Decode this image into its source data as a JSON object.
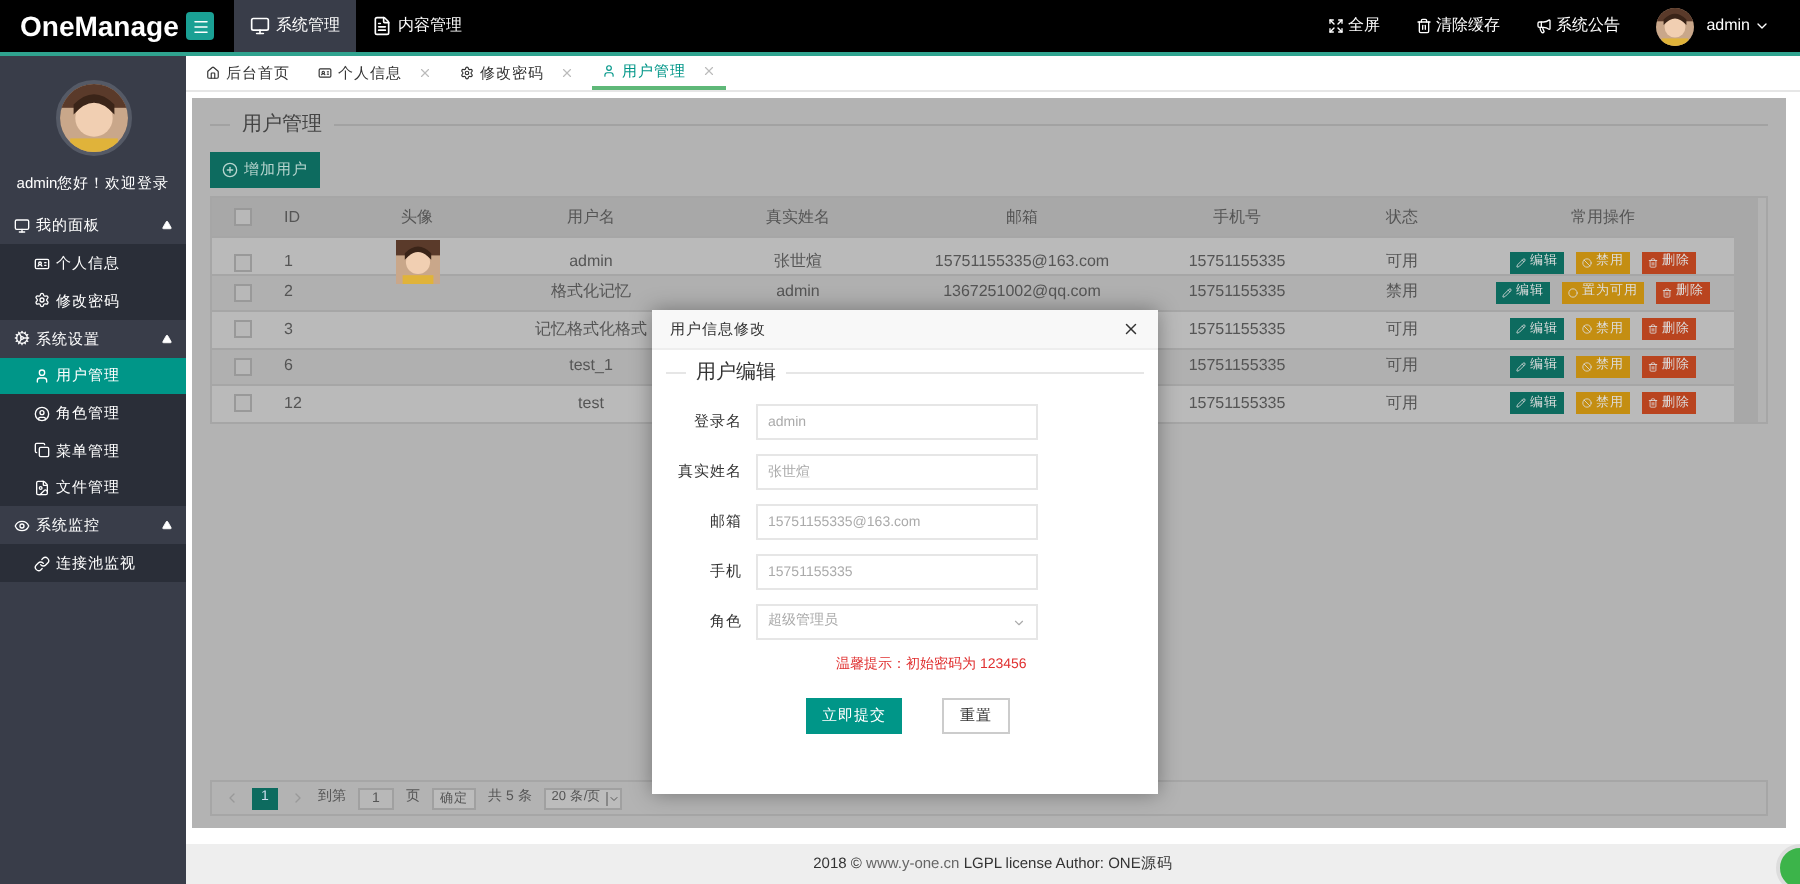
{
  "topbar": {
    "logo": "OneManage",
    "nav": [
      {
        "label": "系统管理",
        "selected": true
      },
      {
        "label": "内容管理",
        "selected": false
      }
    ],
    "actions": [
      "全屏",
      "清除缓存",
      "系统公告"
    ],
    "user": "admin"
  },
  "sidebar": {
    "greeting": "admin您好！欢迎登录",
    "groups": [
      {
        "label": "我的面板",
        "expanded": true,
        "children": [
          {
            "label": "个人信息",
            "selected": false
          },
          {
            "label": "修改密码",
            "selected": false
          }
        ]
      },
      {
        "label": "系统设置",
        "expanded": true,
        "children": [
          {
            "label": "用户管理",
            "selected": true
          },
          {
            "label": "角色管理",
            "selected": false
          },
          {
            "label": "菜单管理",
            "selected": false
          },
          {
            "label": "文件管理",
            "selected": false
          }
        ]
      },
      {
        "label": "系统监控",
        "expanded": true,
        "children": [
          {
            "label": "连接池监视",
            "selected": false
          }
        ]
      }
    ]
  },
  "tabs": [
    {
      "label": "后台首页",
      "closable": false,
      "selected": false
    },
    {
      "label": "个人信息",
      "closable": true,
      "selected": false
    },
    {
      "label": "修改密码",
      "closable": true,
      "selected": false
    },
    {
      "label": "用户管理",
      "closable": true,
      "selected": true
    }
  ],
  "panel": {
    "title": "用户管理",
    "add_button": "增加用户",
    "table": {
      "all_checked": false,
      "columns": [
        "ID",
        "头像",
        "用户名",
        "真实姓名",
        "邮箱",
        "手机号",
        "状态",
        "常用操作"
      ],
      "rows": [
        {
          "checked": false,
          "id": "1",
          "avatar": {
            "kind": "picture"
          },
          "username": "admin",
          "real_name": "张世煊",
          "email": "15751155335@163.com",
          "phone": "15751155335",
          "status": "可用",
          "actions": [
            {
              "kind": "edit",
              "label": "编辑"
            },
            {
              "kind": "disable",
              "label": "禁用"
            },
            {
              "kind": "delete",
              "label": "删除"
            }
          ]
        },
        {
          "checked": false,
          "id": "2",
          "username": "格式化记忆",
          "real_name": "admin",
          "email": "1367251002@qq.com",
          "phone": "15751155335",
          "status": "禁用",
          "actions": [
            {
              "kind": "edit",
              "label": "编辑"
            },
            {
              "kind": "enable",
              "label": "置为可用"
            },
            {
              "kind": "delete",
              "label": "删除"
            }
          ]
        },
        {
          "checked": false,
          "id": "3",
          "username": "记忆格式化格式",
          "phone": "15751155335",
          "status": "可用",
          "actions": [
            {
              "kind": "edit",
              "label": "编辑"
            },
            {
              "kind": "disable",
              "label": "禁用"
            },
            {
              "kind": "delete",
              "label": "删除"
            }
          ]
        },
        {
          "checked": false,
          "id": "6",
          "username": "test_1",
          "phone": "15751155335",
          "status": "可用",
          "actions": [
            {
              "kind": "edit",
              "label": "编辑"
            },
            {
              "kind": "disable",
              "label": "禁用"
            },
            {
              "kind": "delete",
              "label": "删除"
            }
          ]
        },
        {
          "checked": false,
          "id": "12",
          "username": "test",
          "phone": "15751155335",
          "status": "可用",
          "actions": [
            {
              "kind": "edit",
              "label": "编辑"
            },
            {
              "kind": "disable",
              "label": "禁用"
            },
            {
              "kind": "delete",
              "label": "删除"
            }
          ]
        }
      ]
    },
    "pagination": {
      "current": "1",
      "goto_label": "到第",
      "page_input": "1",
      "page_unit": "页",
      "confirm": "确定",
      "total": "共 5 条",
      "page_size": "20 条/页"
    }
  },
  "modal": {
    "title": "用户信息修改",
    "legend": "用户编辑",
    "fields": [
      {
        "kind": "input",
        "label": "登录名",
        "placeholder": "admin"
      },
      {
        "kind": "input",
        "label": "真实姓名",
        "placeholder": "张世煊"
      },
      {
        "kind": "input",
        "label": "邮箱",
        "placeholder": "15751155335@163.com"
      },
      {
        "kind": "input",
        "label": "手机",
        "placeholder": "15751155335"
      },
      {
        "kind": "select",
        "label": "角色",
        "placeholder": "超级管理员"
      }
    ],
    "hint": "温馨提示：初始密码为 123456",
    "submit": "立即提交",
    "reset": "重置"
  },
  "footer": {
    "year": "2018 ©",
    "link": "www.y-one.cn",
    "rest": "LGPL license Author: ONE源码"
  }
}
